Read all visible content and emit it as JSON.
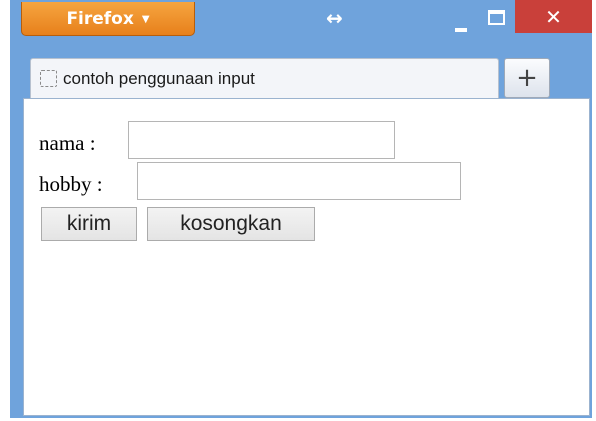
{
  "titlebar": {
    "app_menu_label": "Firefox",
    "app_menu_caret": "▼",
    "resize_glyph": "↔",
    "close_glyph": "✕",
    "close_color": "#c9403a"
  },
  "tabs": [
    {
      "title": "contoh penggunaan input",
      "favicon": "dashed-square-icon"
    }
  ],
  "new_tab_glyph": "+",
  "form": {
    "nama_label": "nama :",
    "nama_value": "",
    "hobby_label": "hobby :",
    "hobby_value": "",
    "submit_label": "kirim",
    "reset_label": "kosongkan"
  },
  "colors": {
    "frame": "#6fa3dc",
    "firefox_button": "#e7801b"
  }
}
